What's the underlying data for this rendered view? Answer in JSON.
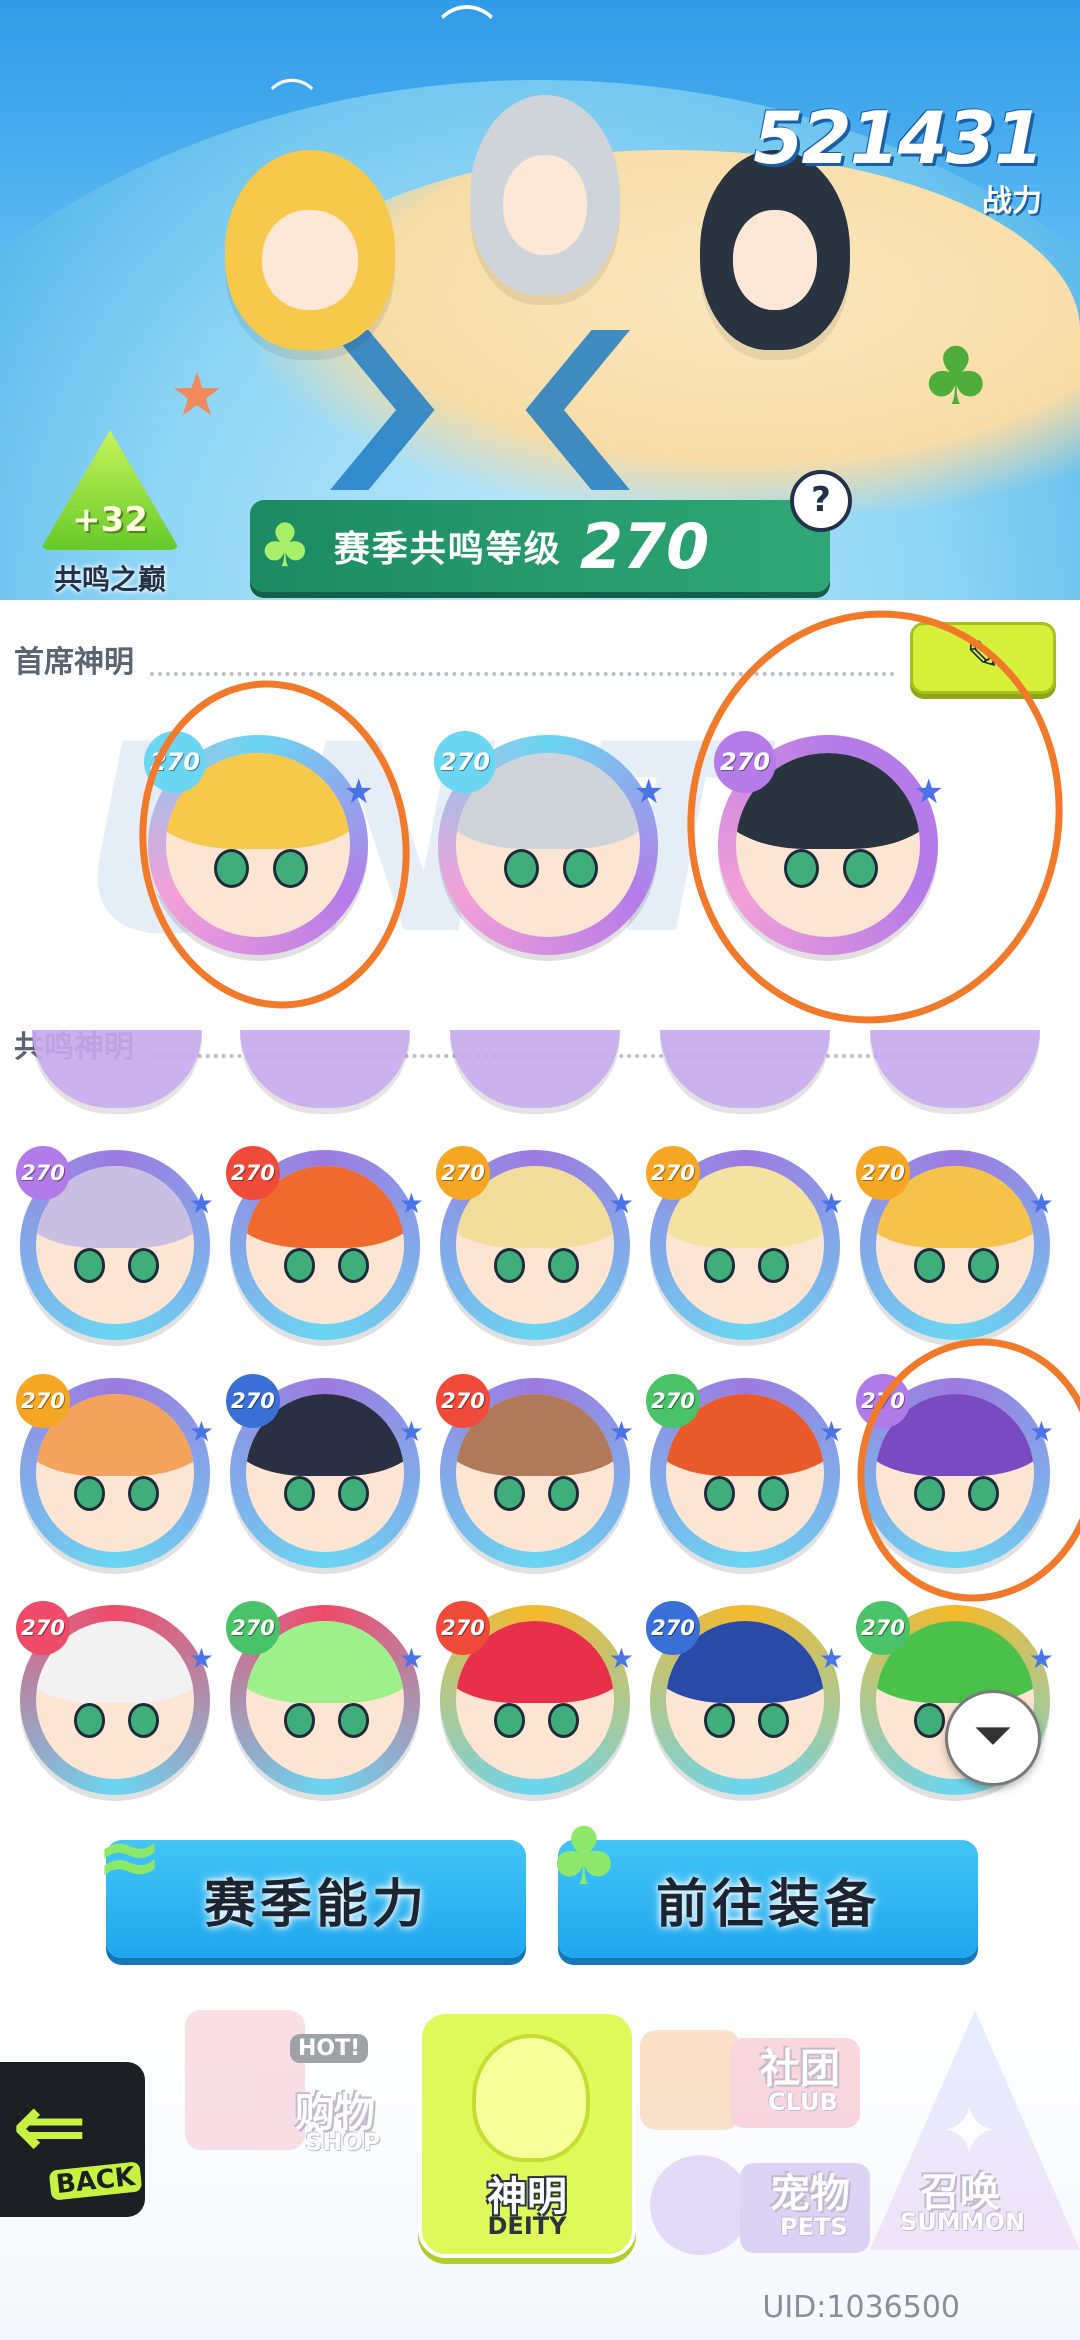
{
  "header": {
    "power_value": "521431",
    "power_label": "战力"
  },
  "resonance_peak": {
    "bonus": "+32",
    "label": "共鸣之巅"
  },
  "season_level": {
    "label": "赛季共鸣等级",
    "value": "270",
    "help_icon": "question-icon"
  },
  "chief_deities": {
    "title": "首席神明",
    "edit_icon": "pencil-edit-icon",
    "watermark": "UNIT",
    "slots": [
      {
        "level": "270",
        "hair": "#f6c94a",
        "ring": "#6ad6f2"
      },
      {
        "level": "270",
        "hair": "#cfd4da",
        "ring": "#6ad6f2"
      },
      {
        "level": "270",
        "hair": "#2a3340",
        "ring": "#b57be8"
      }
    ]
  },
  "resonance_deities": {
    "title": "共鸣神明",
    "rows": [
      [
        {
          "level": "270",
          "hair": "#c9bfe2",
          "ring": "#9c7ae0",
          "badge": "#b07ae8"
        },
        {
          "level": "270",
          "hair": "#f06a2e",
          "ring": "#9c7ae0",
          "badge": "#f04a3a"
        },
        {
          "level": "270",
          "hair": "#f2dc9a",
          "ring": "#9c7ae0",
          "badge": "#f5a623"
        },
        {
          "level": "270",
          "hair": "#f4e2a0",
          "ring": "#9c7ae0",
          "badge": "#f5a623"
        },
        {
          "level": "270",
          "hair": "#f5c24a",
          "ring": "#9c7ae0",
          "badge": "#f5a623"
        }
      ],
      [
        {
          "level": "270",
          "hair": "#f3a35c",
          "ring": "#9c7ae0",
          "badge": "#f5a623"
        },
        {
          "level": "270",
          "hair": "#2a2f44",
          "ring": "#9c7ae0",
          "badge": "#3a6fd8"
        },
        {
          "level": "270",
          "hair": "#b07a5a",
          "ring": "#9c7ae0",
          "badge": "#f04a3a"
        },
        {
          "level": "270",
          "hair": "#e85a2a",
          "ring": "#9c7ae0",
          "badge": "#4ac268"
        },
        {
          "level": "270",
          "hair": "#7a4ac2",
          "ring": "#9c7ae0",
          "badge": "#b07ae8"
        }
      ],
      [
        {
          "level": "270",
          "hair": "#f2f2f2",
          "ring": "#f04a6a",
          "badge": "#f04a6a"
        },
        {
          "level": "270",
          "hair": "#9ef08a",
          "ring": "#f04a6a",
          "badge": "#4ac268"
        },
        {
          "level": "270",
          "hair": "#e8304a",
          "ring": "#f5b92a",
          "badge": "#f04a3a"
        },
        {
          "level": "270",
          "hair": "#2a4aa8",
          "ring": "#f5b92a",
          "badge": "#3a6fd8"
        },
        {
          "level": "270",
          "hair": "#4ac24a",
          "ring": "#f5b92a",
          "badge": "#4ac268"
        }
      ]
    ],
    "filter_icon": "filter-icon"
  },
  "actions": {
    "season_ability": "赛季能力",
    "go_equipment": "前往装备"
  },
  "nav": {
    "back_label": "BACK",
    "shop_cn": "购物",
    "shop_en": "SHOP",
    "shop_badge": "HOT!",
    "deity_cn": "神明",
    "deity_en": "DEITY",
    "club_cn": "社团",
    "club_en": "CLUB",
    "pets_cn": "宠物",
    "pets_en": "PETS",
    "summon_cn": "召唤",
    "summon_en": "SUMMON"
  },
  "uid": "UID:1036500",
  "colors": {
    "annotation": "#f07a2a",
    "accent_green": "#d6f03a",
    "button_blue": "#1ea6ee",
    "level_bar": "#1c8a62"
  }
}
